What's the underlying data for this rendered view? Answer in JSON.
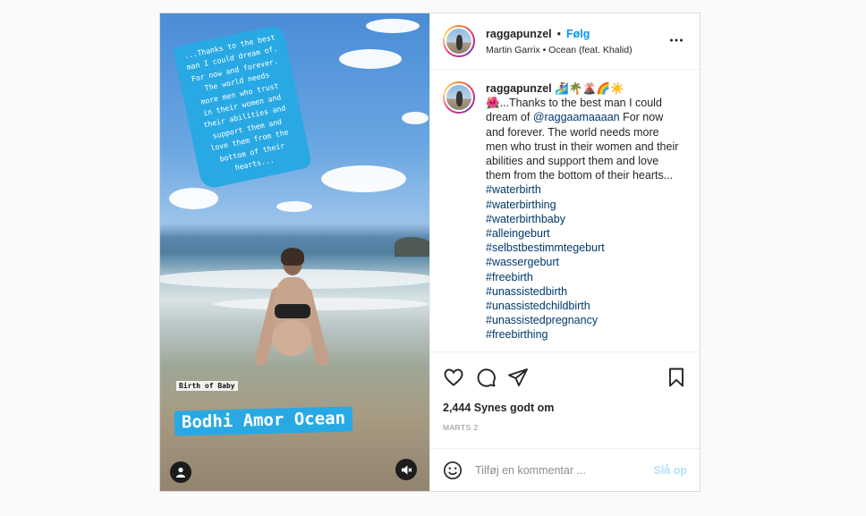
{
  "header": {
    "username": "raggapunzel",
    "separator": "•",
    "follow_label": "Følg",
    "audio": "Martin Garrix • Ocean (feat. Khalid)"
  },
  "media": {
    "story_caption_lines": [
      "...Thanks to the best",
      "man I could dream of.",
      "For now and forever.",
      "The world needs",
      "more men who trust",
      "in their women and",
      "their abilities and",
      "support them and",
      "love them from the",
      "bottom of their",
      "hearts..."
    ],
    "sticker_small": "Birth of Baby",
    "sticker_big": "Bodhi Amor Ocean"
  },
  "caption": {
    "username": "raggapunzel",
    "username_emojis": "🏄‍♀️🌴🌋🌈☀️",
    "text_start": "🌺...Thanks to the best man I could dream of ",
    "mention": "@raggaamaaaan",
    "text_end": " For now and forever. The world needs more men who trust in their women and their abilities and support them and love them from the bottom of their hearts...",
    "hashtags": [
      "#waterbirth",
      "#waterbirthing",
      "#waterbirthbaby",
      "#alleingeburt",
      "#selbstbestimmtegeburt",
      "#wassergeburt",
      "#freebirth",
      "#unassistedbirth",
      "#unassistedchildbirth",
      "#unassistedpregnancy",
      "#freebirthing"
    ]
  },
  "likes": "2,444 Synes godt om",
  "date": "MARTS 2",
  "comment": {
    "placeholder": "Tilføj en kommentar ...",
    "post_label": "Slå op"
  },
  "icons": [
    "user-tag-icon",
    "muted-speaker-icon",
    "more-options-icon",
    "heart-icon",
    "comment-icon",
    "share-icon",
    "bookmark-icon",
    "emoji-icon"
  ],
  "colors": {
    "accent": "#0095f6",
    "hashtag": "#00376b",
    "sticker": "#29a9e3",
    "post_disabled": "#b2dffc"
  }
}
